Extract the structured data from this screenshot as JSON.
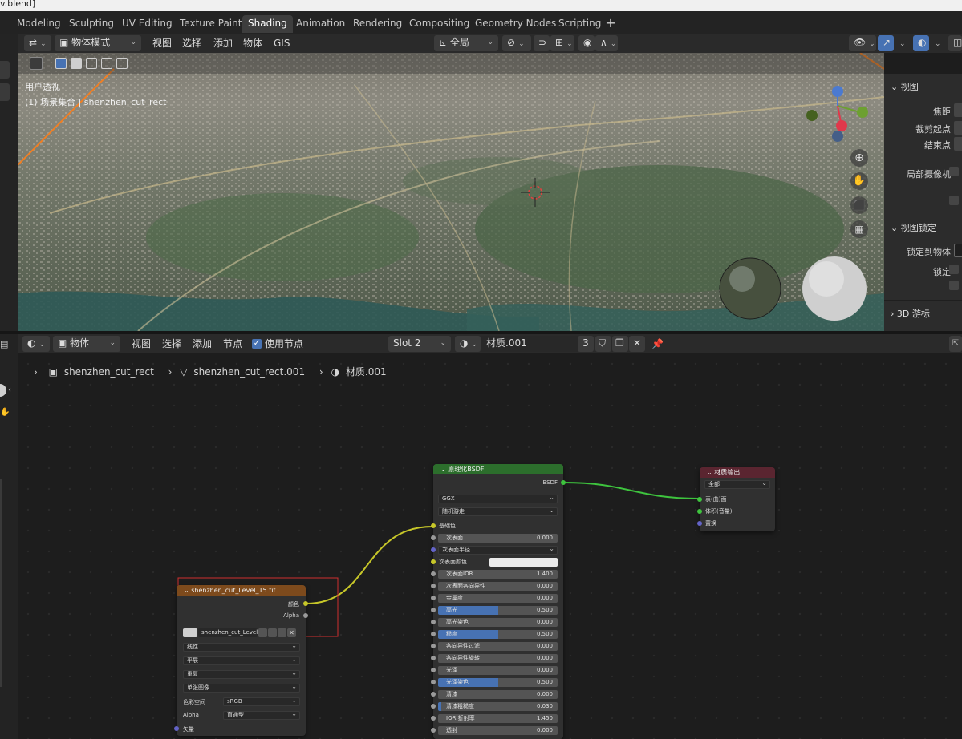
{
  "window": {
    "title": "v.blend]"
  },
  "workspaces": {
    "tabs": [
      {
        "label": "Modeling"
      },
      {
        "label": "Sculpting"
      },
      {
        "label": "UV Editing"
      },
      {
        "label": "Texture Paint"
      },
      {
        "label": "Shading"
      },
      {
        "label": "Animation"
      },
      {
        "label": "Rendering"
      },
      {
        "label": "Compositing"
      },
      {
        "label": "Geometry Nodes"
      },
      {
        "label": "Scripting"
      }
    ],
    "active": "Shading",
    "add": "+"
  },
  "viewport_header": {
    "mode": "物体模式",
    "menus": [
      "视图",
      "选择",
      "添加",
      "物体",
      "GIS"
    ],
    "orientation": "全局"
  },
  "viewport": {
    "info_line1": "用户透视",
    "info_line2": "(1) 场景集合 | shenzhen_cut_rect"
  },
  "n_panel": {
    "view_section": "视图",
    "focal": "焦距",
    "clip_start": "裁剪起点",
    "clip_end": "结束点",
    "local_camera": "局部摄像机",
    "view_lock_section": "视图锁定",
    "lock_to_object": "锁定到物体",
    "lock": "锁定",
    "cursor_section": "3D 游标"
  },
  "node_header": {
    "type": "物体",
    "menus": [
      "视图",
      "选择",
      "添加",
      "节点"
    ],
    "use_nodes_label": "使用节点",
    "use_nodes": true,
    "slot": "Slot 2",
    "material_name": "材质.001",
    "user_count": "3"
  },
  "breadcrumb": {
    "object": "shenzhen_cut_rect",
    "mesh": "shenzhen_cut_rect.001",
    "material": "材质.001"
  },
  "nodes": {
    "image_texture": {
      "title": "shenzhen_cut_Level_15.tif",
      "outputs": [
        "颜色",
        "Alpha"
      ],
      "image_name": "shenzhen_cut_Level...",
      "interpolation": "线性",
      "projection": "平展",
      "extension": "重复",
      "source": "单张图像",
      "colorspace_label": "色彩空间",
      "colorspace": "sRGB",
      "alpha_label": "Alpha",
      "alpha_mode": "直通型",
      "vector_input": "矢量"
    },
    "principled": {
      "title": "原理化BSDF",
      "output": "BSDF",
      "distribution": "GGX",
      "subsurface_method": "随机游走",
      "base_color": "基础色",
      "subsurface": {
        "label": "次表面",
        "value": "0.000"
      },
      "subsurface_radius": "次表面半径",
      "subsurface_color": "次表面颜色",
      "fields": [
        {
          "label": "次表面IOR",
          "value": "1.400",
          "fill": 0.0
        },
        {
          "label": "次表面各向异性",
          "value": "0.000",
          "fill": 0.0
        },
        {
          "label": "金属度",
          "value": "0.000",
          "fill": 0.0
        },
        {
          "label": "高光",
          "value": "0.500",
          "fill": 0.5
        },
        {
          "label": "高光染色",
          "value": "0.000",
          "fill": 0.0
        },
        {
          "label": "糙度",
          "value": "0.500",
          "fill": 0.5
        },
        {
          "label": "各向异性过滤",
          "value": "0.000",
          "fill": 0.0
        },
        {
          "label": "各向异性旋转",
          "value": "0.000",
          "fill": 0.0
        },
        {
          "label": "光泽",
          "value": "0.000",
          "fill": 0.0
        },
        {
          "label": "光泽染色",
          "value": "0.500",
          "fill": 0.5
        },
        {
          "label": "清漆",
          "value": "0.000",
          "fill": 0.0
        },
        {
          "label": "清漆粗糙度",
          "value": "0.030",
          "fill": 0.03
        },
        {
          "label": "IOR 折射率",
          "value": "1.450",
          "fill": 0.0
        },
        {
          "label": "透射",
          "value": "0.000",
          "fill": 0.0
        }
      ]
    },
    "material_output": {
      "title": "材质输出",
      "target": "全部",
      "inputs": [
        "表(曲)面",
        "体积(音量)",
        "置换"
      ]
    }
  },
  "colors": {
    "accent": "#4772b3",
    "texture_header": "#7d4a1c",
    "shader_header": "#2c6e2c",
    "output_header": "#5a2530",
    "selection_rect": "#d03030"
  }
}
